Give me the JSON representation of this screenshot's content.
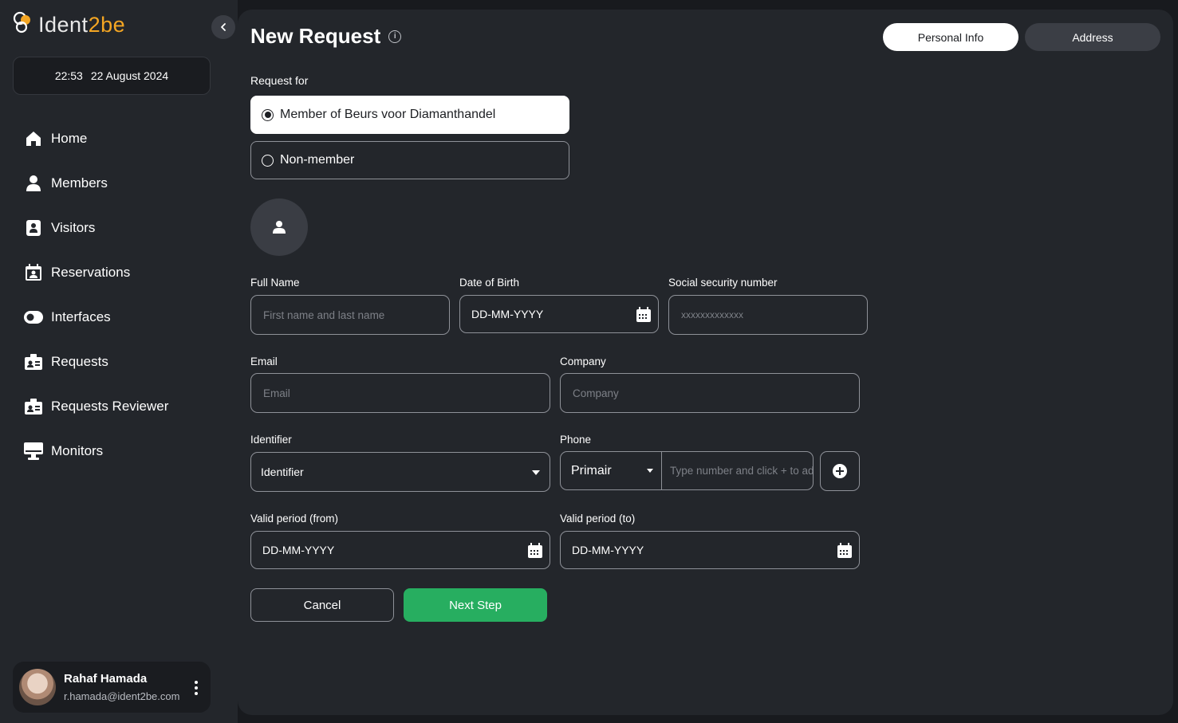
{
  "app": {
    "logo_text_main": "Ident",
    "logo_text_accent": "2be"
  },
  "header": {
    "time": "22:53",
    "date": "22 August 2024"
  },
  "sidebar": {
    "items": [
      {
        "label": "Home",
        "icon": "home-icon"
      },
      {
        "label": "Members",
        "icon": "person-icon"
      },
      {
        "label": "Visitors",
        "icon": "badge-icon"
      },
      {
        "label": "Reservations",
        "icon": "calendar-person-icon"
      },
      {
        "label": "Interfaces",
        "icon": "toggle-icon"
      },
      {
        "label": "Requests",
        "icon": "id-card-icon"
      },
      {
        "label": "Requests Reviewer",
        "icon": "id-card-icon"
      },
      {
        "label": "Monitors",
        "icon": "monitor-icon"
      }
    ]
  },
  "user": {
    "name": "Rahaf Hamada",
    "email": "r.hamada@ident2be.com"
  },
  "page": {
    "title": "New Request"
  },
  "steps": [
    {
      "label": "Personal Info",
      "active": true
    },
    {
      "label": "Address",
      "active": false
    }
  ],
  "form": {
    "request_for_label": "Request for",
    "options": [
      {
        "label": "Member of Beurs voor Diamanthandel",
        "selected": true
      },
      {
        "label": "Non-member",
        "selected": false
      }
    ],
    "full_name": {
      "label": "Full Name",
      "placeholder": "First name and last name"
    },
    "dob": {
      "label": "Date of Birth",
      "value": "DD-MM-YYYY"
    },
    "ssn": {
      "label": "Social security number",
      "placeholder": "xxxxxxxxxxxxx"
    },
    "email": {
      "label": "Email",
      "placeholder": "Email"
    },
    "company": {
      "label": "Company",
      "placeholder": "Company"
    },
    "identifier": {
      "label": "Identifier",
      "value": "Identifier"
    },
    "phone": {
      "label": "Phone",
      "type": "Primair",
      "placeholder": "Type number and click + to add"
    },
    "valid_from": {
      "label": "Valid period (from)",
      "value": "DD-MM-YYYY"
    },
    "valid_to": {
      "label": "Valid period (to)",
      "value": "DD-MM-YYYY"
    }
  },
  "actions": {
    "cancel": "Cancel",
    "next": "Next Step"
  },
  "colors": {
    "accent_green": "#27ae60",
    "logo_orange": "#f4a623",
    "panel": "#23262b",
    "background": "#181a1e"
  }
}
